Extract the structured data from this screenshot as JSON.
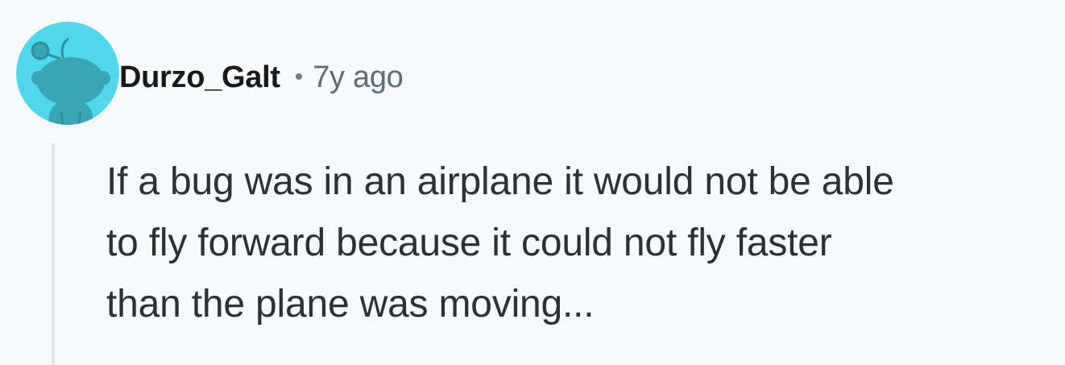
{
  "comment": {
    "author": "Durzo_Galt",
    "separator": "•",
    "timestamp": "7y ago",
    "body_lines": [
      "If a bug was in an airplane it would not be able",
      "to fly forward because it could not fly faster",
      "than the plane was moving..."
    ]
  },
  "avatar": {
    "icon": "snoo-avatar-icon",
    "background_color": "#4fd8eb",
    "figure_color": "#3aa6b5"
  },
  "colors": {
    "background": "#f7f9fb",
    "thread_line": "#dde3e8",
    "text": "#2a3138",
    "meta": "#5c6c79"
  }
}
